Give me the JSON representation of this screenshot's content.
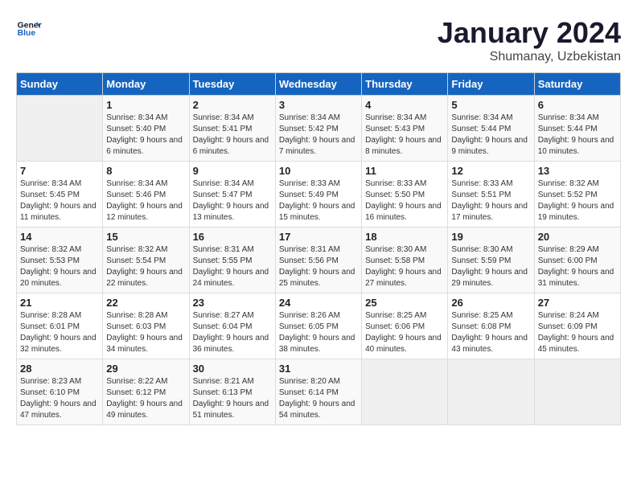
{
  "header": {
    "logo_line1": "General",
    "logo_line2": "Blue",
    "month": "January 2024",
    "location": "Shumanay, Uzbekistan"
  },
  "days_of_week": [
    "Sunday",
    "Monday",
    "Tuesday",
    "Wednesday",
    "Thursday",
    "Friday",
    "Saturday"
  ],
  "weeks": [
    [
      {
        "day": "",
        "sunrise": "",
        "sunset": "",
        "daylight": ""
      },
      {
        "day": "1",
        "sunrise": "8:34 AM",
        "sunset": "5:40 PM",
        "daylight": "9 hours and 6 minutes."
      },
      {
        "day": "2",
        "sunrise": "8:34 AM",
        "sunset": "5:41 PM",
        "daylight": "9 hours and 6 minutes."
      },
      {
        "day": "3",
        "sunrise": "8:34 AM",
        "sunset": "5:42 PM",
        "daylight": "9 hours and 7 minutes."
      },
      {
        "day": "4",
        "sunrise": "8:34 AM",
        "sunset": "5:43 PM",
        "daylight": "9 hours and 8 minutes."
      },
      {
        "day": "5",
        "sunrise": "8:34 AM",
        "sunset": "5:44 PM",
        "daylight": "9 hours and 9 minutes."
      },
      {
        "day": "6",
        "sunrise": "8:34 AM",
        "sunset": "5:44 PM",
        "daylight": "9 hours and 10 minutes."
      }
    ],
    [
      {
        "day": "7",
        "sunrise": "8:34 AM",
        "sunset": "5:45 PM",
        "daylight": "9 hours and 11 minutes."
      },
      {
        "day": "8",
        "sunrise": "8:34 AM",
        "sunset": "5:46 PM",
        "daylight": "9 hours and 12 minutes."
      },
      {
        "day": "9",
        "sunrise": "8:34 AM",
        "sunset": "5:47 PM",
        "daylight": "9 hours and 13 minutes."
      },
      {
        "day": "10",
        "sunrise": "8:33 AM",
        "sunset": "5:49 PM",
        "daylight": "9 hours and 15 minutes."
      },
      {
        "day": "11",
        "sunrise": "8:33 AM",
        "sunset": "5:50 PM",
        "daylight": "9 hours and 16 minutes."
      },
      {
        "day": "12",
        "sunrise": "8:33 AM",
        "sunset": "5:51 PM",
        "daylight": "9 hours and 17 minutes."
      },
      {
        "day": "13",
        "sunrise": "8:32 AM",
        "sunset": "5:52 PM",
        "daylight": "9 hours and 19 minutes."
      }
    ],
    [
      {
        "day": "14",
        "sunrise": "8:32 AM",
        "sunset": "5:53 PM",
        "daylight": "9 hours and 20 minutes."
      },
      {
        "day": "15",
        "sunrise": "8:32 AM",
        "sunset": "5:54 PM",
        "daylight": "9 hours and 22 minutes."
      },
      {
        "day": "16",
        "sunrise": "8:31 AM",
        "sunset": "5:55 PM",
        "daylight": "9 hours and 24 minutes."
      },
      {
        "day": "17",
        "sunrise": "8:31 AM",
        "sunset": "5:56 PM",
        "daylight": "9 hours and 25 minutes."
      },
      {
        "day": "18",
        "sunrise": "8:30 AM",
        "sunset": "5:58 PM",
        "daylight": "9 hours and 27 minutes."
      },
      {
        "day": "19",
        "sunrise": "8:30 AM",
        "sunset": "5:59 PM",
        "daylight": "9 hours and 29 minutes."
      },
      {
        "day": "20",
        "sunrise": "8:29 AM",
        "sunset": "6:00 PM",
        "daylight": "9 hours and 31 minutes."
      }
    ],
    [
      {
        "day": "21",
        "sunrise": "8:28 AM",
        "sunset": "6:01 PM",
        "daylight": "9 hours and 32 minutes."
      },
      {
        "day": "22",
        "sunrise": "8:28 AM",
        "sunset": "6:03 PM",
        "daylight": "9 hours and 34 minutes."
      },
      {
        "day": "23",
        "sunrise": "8:27 AM",
        "sunset": "6:04 PM",
        "daylight": "9 hours and 36 minutes."
      },
      {
        "day": "24",
        "sunrise": "8:26 AM",
        "sunset": "6:05 PM",
        "daylight": "9 hours and 38 minutes."
      },
      {
        "day": "25",
        "sunrise": "8:25 AM",
        "sunset": "6:06 PM",
        "daylight": "9 hours and 40 minutes."
      },
      {
        "day": "26",
        "sunrise": "8:25 AM",
        "sunset": "6:08 PM",
        "daylight": "9 hours and 43 minutes."
      },
      {
        "day": "27",
        "sunrise": "8:24 AM",
        "sunset": "6:09 PM",
        "daylight": "9 hours and 45 minutes."
      }
    ],
    [
      {
        "day": "28",
        "sunrise": "8:23 AM",
        "sunset": "6:10 PM",
        "daylight": "9 hours and 47 minutes."
      },
      {
        "day": "29",
        "sunrise": "8:22 AM",
        "sunset": "6:12 PM",
        "daylight": "9 hours and 49 minutes."
      },
      {
        "day": "30",
        "sunrise": "8:21 AM",
        "sunset": "6:13 PM",
        "daylight": "9 hours and 51 minutes."
      },
      {
        "day": "31",
        "sunrise": "8:20 AM",
        "sunset": "6:14 PM",
        "daylight": "9 hours and 54 minutes."
      },
      {
        "day": "",
        "sunrise": "",
        "sunset": "",
        "daylight": ""
      },
      {
        "day": "",
        "sunrise": "",
        "sunset": "",
        "daylight": ""
      },
      {
        "day": "",
        "sunrise": "",
        "sunset": "",
        "daylight": ""
      }
    ]
  ]
}
